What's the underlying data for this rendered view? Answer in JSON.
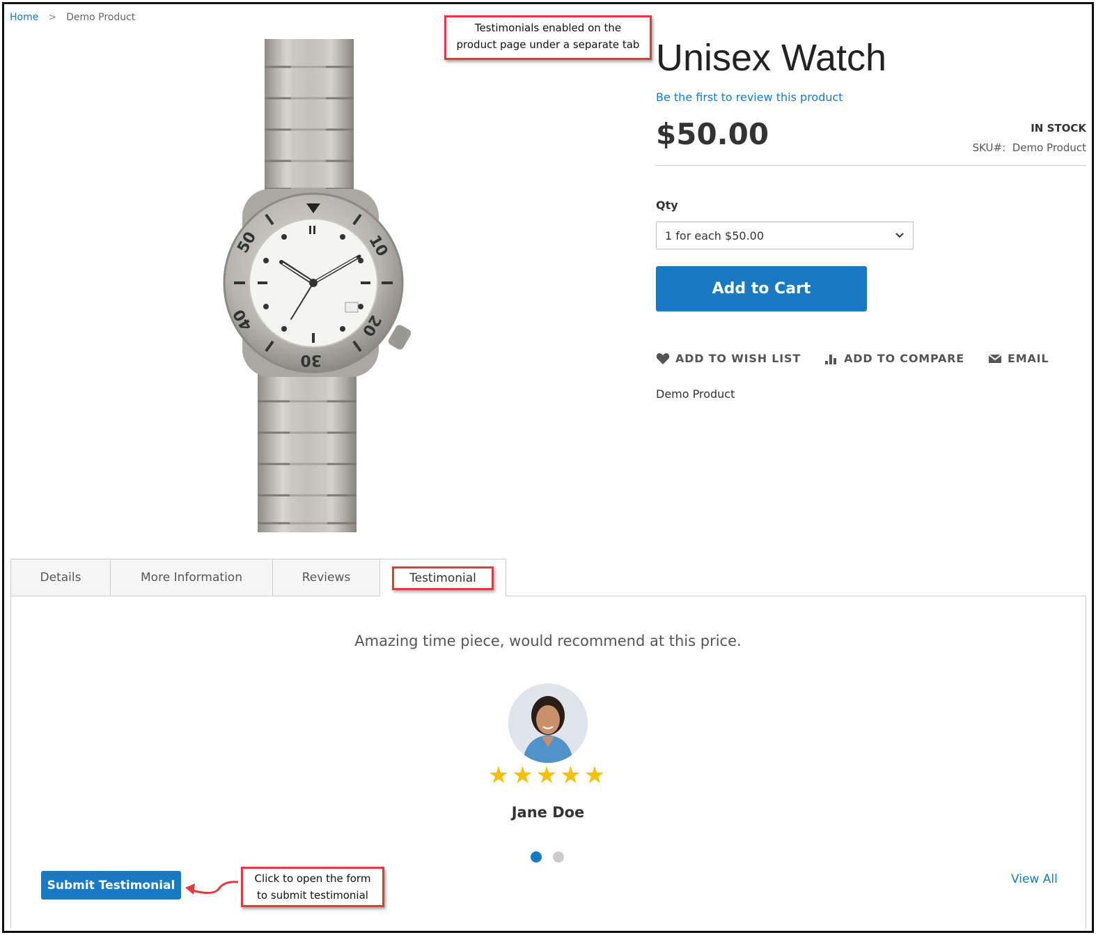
{
  "breadcrumb": {
    "home": "Home",
    "separator": ">",
    "current": "Demo Product"
  },
  "annotations": {
    "top_line1": "Testimonials enabled on the",
    "top_line2": "product page under a separate tab",
    "bottom_line1": "Click to open the form",
    "bottom_line2": "to submit testimonial"
  },
  "product": {
    "title": "Unisex Watch",
    "review_link": "Be the first to review this product",
    "price": "$50.00",
    "stock": "IN STOCK",
    "sku_label": "SKU#:",
    "sku_value": "Demo Product",
    "qty_label": "Qty",
    "qty_selected": "1 for each $50.00",
    "add_to_cart": "Add to Cart",
    "wishlist": "ADD TO WISH LIST",
    "compare": "ADD TO COMPARE",
    "email": "EMAIL",
    "short_description": "Demo Product"
  },
  "tabs": [
    {
      "label": "Details"
    },
    {
      "label": "More Information"
    },
    {
      "label": "Reviews"
    },
    {
      "label": "Testimonial"
    }
  ],
  "testimonial": {
    "quote": "Amazing time piece, would recommend at this price.",
    "rating": 5,
    "stars": "★★★★★",
    "author": "Jane Doe",
    "slide_count": 2,
    "active_slide": 1,
    "submit_label": "Submit Testimonial",
    "view_all": "View All"
  },
  "colors": {
    "accent": "#1979c3",
    "annotation": "#e0393e",
    "star": "#f6c000"
  }
}
